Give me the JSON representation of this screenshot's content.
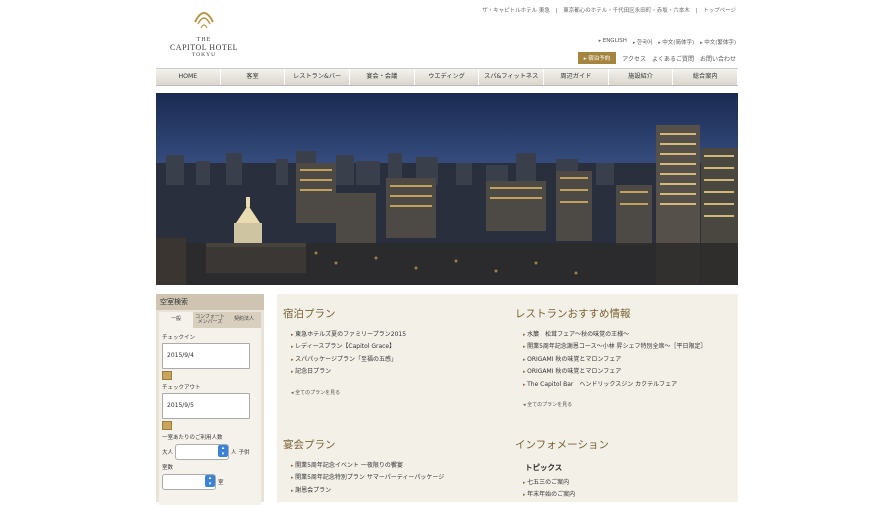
{
  "header": {
    "top_links": [
      "ザ・キャピトルホテル 東急",
      "東京都心のホテル・千代田区永田町・赤坂・六本木",
      "トップページ"
    ],
    "logo": {
      "line1": "THE",
      "line2": "CAPITOL HOTEL",
      "line3": "TOKYU"
    },
    "languages": [
      "ENGLISH",
      "한국어",
      "中文(简体字)",
      "中文(繁体字)"
    ],
    "reserve_label": "宿泊予約",
    "sub_links": [
      "アクセス",
      "よくあるご質問",
      "お問い合わせ"
    ]
  },
  "global_nav": [
    "HOME",
    "客室",
    "レストラン&バー",
    "宴会・会議",
    "ウエディング",
    "スパ&フィットネス",
    "周辺ガイド",
    "施設紹介",
    "総合案内"
  ],
  "sidebar": {
    "title": "空室検索",
    "tabs": [
      "一般",
      "コンフォートメンバーズ",
      "契約法人"
    ],
    "checkin_label": "チェックイン",
    "checkin_value": "2015/9/4",
    "checkout_label": "チェックアウト",
    "checkout_value": "2015/9/5",
    "guests_label": "一室あたりのご利用人数",
    "adult_label": "大人",
    "adult_unit": "人",
    "child_label": "子供",
    "rooms_label": "室数",
    "rooms_unit": "室"
  },
  "sections": {
    "stay": {
      "title": "宿泊プラン",
      "items": [
        "東急ホテルズ夏のファミリープラン2015",
        "レディースプラン【Capitol Grace】",
        "スパパッケージプラン「至福の五感」",
        "記念日プラン"
      ],
      "all_link": "全てのプランを見る"
    },
    "restaurant": {
      "title": "レストランおすすめ情報",
      "items": [
        "水簾　松茸フェア～秋の味覚の王様～",
        "開業5周年記念謝恩コース～小林 昇シェフ特別全席～［平日限定］",
        "ORIGAMI 秋の味覚とマロンフェア",
        "ORIGAMI 秋の味覚とマロンフェア",
        "The Capitol Bar　ヘンドリックスジン カクテルフェア"
      ],
      "all_link": "全てのプランを見る"
    },
    "banquet": {
      "title": "宴会プラン",
      "items": [
        "開業5周年記念イベント 一夜限りの饗宴",
        "開業5周年記念特別プラン サマーパーティーパッケージ",
        "謝恩会プラン"
      ]
    },
    "info": {
      "title": "インフォメーション",
      "subtitle": "トピックス",
      "items": [
        "七五三のご案内",
        "年末年始のご案内"
      ]
    }
  },
  "colors": {
    "accent": "#a5843f",
    "panel": "#f3f0e8",
    "sidebar": "#e8e2d7"
  }
}
